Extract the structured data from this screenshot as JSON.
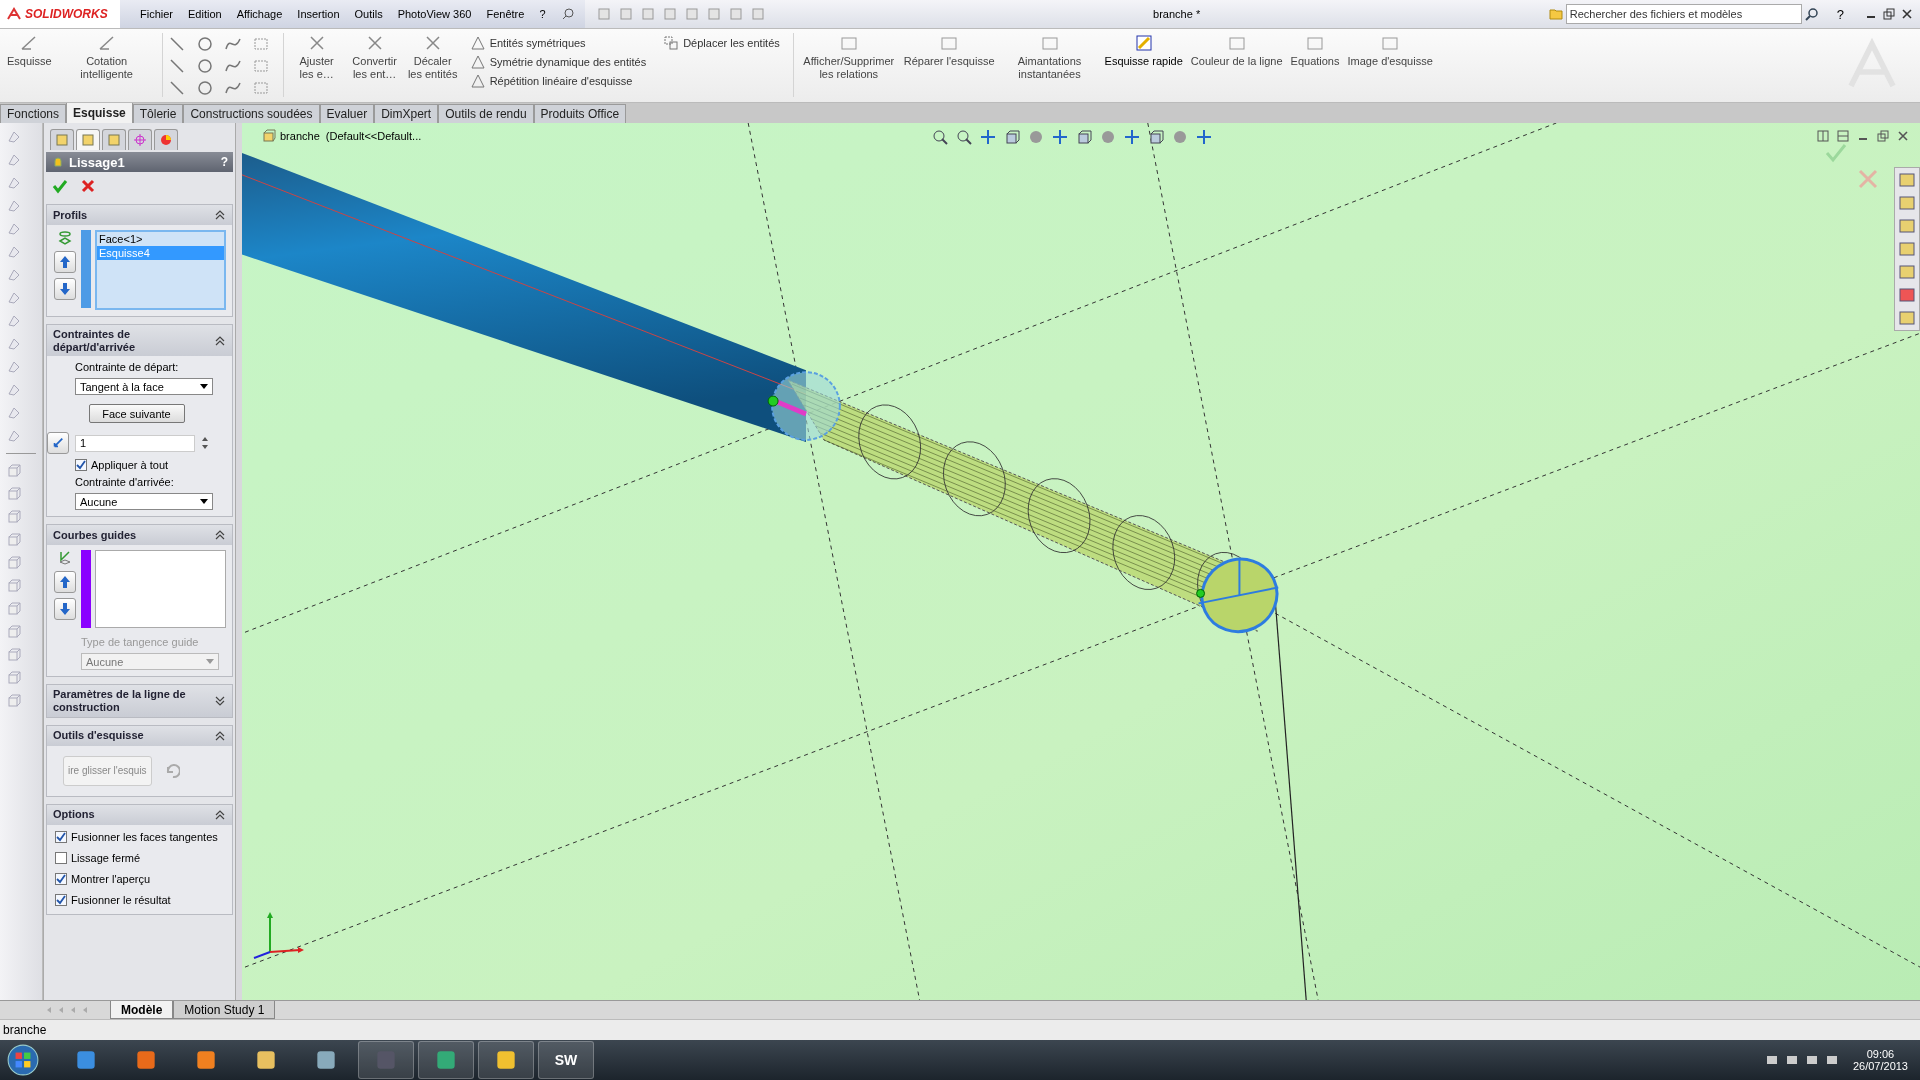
{
  "title_bar": {
    "logo": "SOLIDWORKS",
    "menu": [
      "Fichier",
      "Edition",
      "Affichage",
      "Insertion",
      "Outils",
      "PhotoView 360",
      "Fenêtre",
      "?"
    ],
    "document_title": "branche *",
    "search": {
      "placeholder": "Rechercher des fichiers et modèles"
    },
    "help": "?"
  },
  "ribbon": {
    "left": [
      "Esquisse",
      "Cotation intelligente"
    ],
    "trim": [
      "Ajuster les e…",
      "Convertir les ent…",
      "Décaler les entités"
    ],
    "list": [
      "Entités symétriques",
      "Symétrie dynamique des entités",
      "Répétition linéaire d'esquisse"
    ],
    "move": "Déplacer les entités",
    "right": [
      {
        "label": "Afficher/Supprimer les relations",
        "active": false
      },
      {
        "label": "Réparer l'esquisse",
        "active": false
      },
      {
        "label": "Aimantations instantanées",
        "active": false
      },
      {
        "label": "Esquisse rapide",
        "active": true
      },
      {
        "label": "Couleur de la ligne",
        "active": false
      },
      {
        "label": "Equations",
        "active": false
      },
      {
        "label": "Image d'esquisse",
        "active": false
      }
    ]
  },
  "command_tabs": [
    {
      "label": "Fonctions",
      "selected": false
    },
    {
      "label": "Esquisse",
      "selected": true
    },
    {
      "label": "Tôlerie",
      "selected": false
    },
    {
      "label": "Constructions soudées",
      "selected": false
    },
    {
      "label": "Evaluer",
      "selected": false
    },
    {
      "label": "DimXpert",
      "selected": false
    },
    {
      "label": "Outils de rendu",
      "selected": false
    },
    {
      "label": "Produits Office",
      "selected": false
    }
  ],
  "property_manager": {
    "panel_tabs": [
      {
        "selected": false
      },
      {
        "selected": true
      },
      {
        "selected": false
      },
      {
        "selected": false
      },
      {
        "selected": false
      }
    ],
    "title": "Lissage1",
    "help": "?",
    "profiles": {
      "title": "Profils",
      "expanded": true,
      "items": [
        {
          "label": "Face<1>",
          "selected": false
        },
        {
          "label": "Esquisse4",
          "selected": true
        }
      ]
    },
    "constraints": {
      "title": "Contraintes de départ/d'arrivée",
      "expanded": true,
      "start_label": "Contrainte de départ:",
      "start_value": "Tangent à la face",
      "next_face_button": "Face suivante",
      "tangent_length": "1",
      "apply_all": {
        "label": "Appliquer à tout",
        "checked": true
      },
      "end_label": "Contrainte d'arrivée:",
      "end_value": "Aucune"
    },
    "guides": {
      "title": "Courbes guides",
      "expanded": true,
      "tangency_label": "Type de tangence guide",
      "tangency_value": "Aucune",
      "disabled": true
    },
    "centerline": {
      "title": "Paramètres de la ligne de construction",
      "expanded": false
    },
    "sketch_tools": {
      "title": "Outils d'esquisse",
      "expanded": true,
      "drag_button": "ire glisser l'esquis"
    },
    "options": {
      "title": "Options",
      "expanded": true,
      "checkboxes": [
        {
          "label": "Fusionner les faces tangentes",
          "checked": true
        },
        {
          "label": "Lissage fermé",
          "checked": false
        },
        {
          "label": "Montrer l'aperçu",
          "checked": true
        },
        {
          "label": "Fusionner le résultat",
          "checked": true
        }
      ]
    }
  },
  "viewport": {
    "tree_label": "branche  (Default<<Default..."
  },
  "model_tabs": [
    {
      "label": "Modèle",
      "selected": true
    },
    {
      "label": "Motion Study 1",
      "selected": false
    }
  ],
  "status_bar": "branche",
  "taskbar": {
    "sw_label": "SW",
    "time": "09:06",
    "date": "26/07/2013"
  }
}
